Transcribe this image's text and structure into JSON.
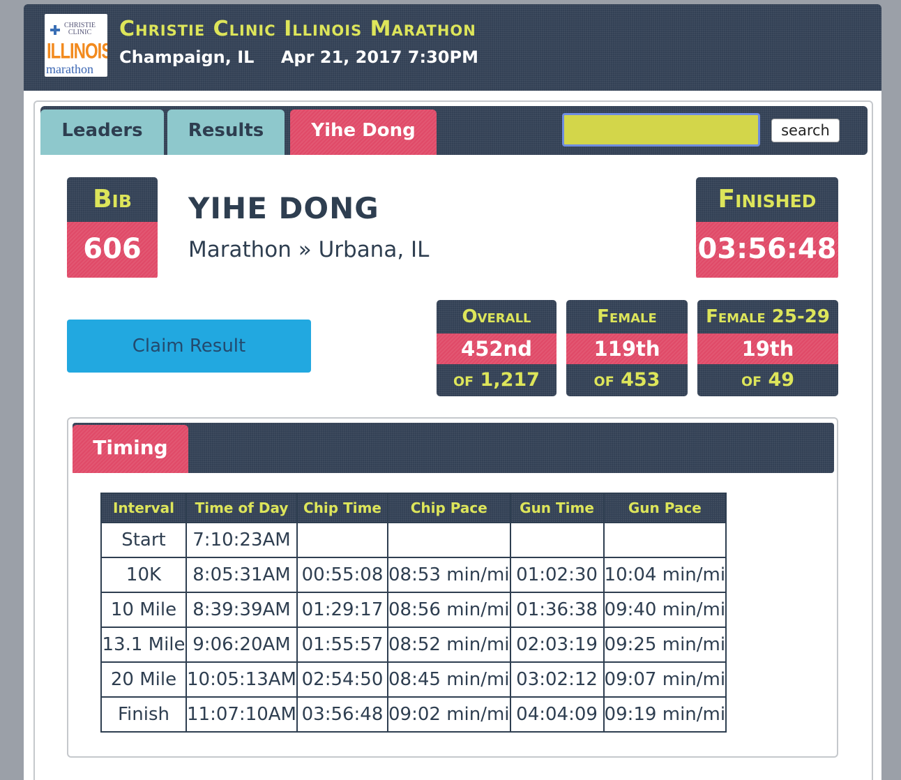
{
  "header": {
    "logo": {
      "top_text": [
        "CHRISTIE",
        "CLINIC"
      ],
      "wordmark": "ILLINOIS",
      "sub": "marathon"
    },
    "title": "Christie Clinic Illinois Marathon",
    "location": "Champaign, IL",
    "datetime": "Apr 21, 2017 7:30PM"
  },
  "tabs": {
    "leaders": "Leaders",
    "results": "Results",
    "person": "Yihe Dong"
  },
  "search": {
    "value": "",
    "button": "search"
  },
  "runner": {
    "bib_label": "Bib",
    "bib": "606",
    "name": "YIHE DONG",
    "detail": "Marathon » Urbana, IL",
    "finished_label": "Finished",
    "finish_time": "03:56:48"
  },
  "claim_label": "Claim Result",
  "ranks": {
    "overall": {
      "label": "Overall",
      "place": "452nd",
      "of": "of 1,217"
    },
    "gender": {
      "label": "Female",
      "place": "119th",
      "of": "of 453"
    },
    "age": {
      "label": "Female 25-29",
      "place": "19th",
      "of": "of 49"
    }
  },
  "timing": {
    "tab": "Timing",
    "columns": [
      "Interval",
      "Time of Day",
      "Chip Time",
      "Chip Pace",
      "Gun Time",
      "Gun Pace"
    ],
    "rows": [
      [
        "Start",
        "7:10:23AM",
        "",
        "",
        "",
        ""
      ],
      [
        "10K",
        "8:05:31AM",
        "00:55:08",
        "08:53 min/mi",
        "01:02:30",
        "10:04 min/mi"
      ],
      [
        "10 Mile",
        "8:39:39AM",
        "01:29:17",
        "08:56 min/mi",
        "01:36:38",
        "09:40 min/mi"
      ],
      [
        "13.1 Mile",
        "9:06:20AM",
        "01:55:57",
        "08:52 min/mi",
        "02:03:19",
        "09:25 min/mi"
      ],
      [
        "20 Mile",
        "10:05:13AM",
        "02:54:50",
        "08:45 min/mi",
        "03:02:12",
        "09:07 min/mi"
      ],
      [
        "Finish",
        "11:07:10AM",
        "03:56:48",
        "09:02 min/mi",
        "04:04:09",
        "09:19 min/mi"
      ]
    ]
  }
}
